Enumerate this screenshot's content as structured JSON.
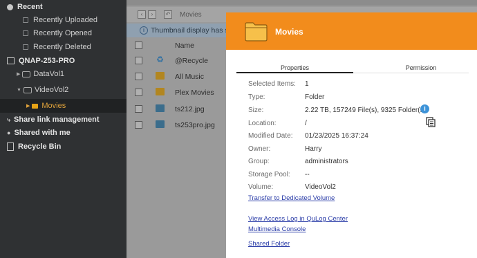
{
  "sidebar": {
    "recent": "Recent",
    "recent_items": [
      "Recently Uploaded",
      "Recently Opened",
      "Recently Deleted"
    ],
    "nas": "QNAP-253-PRO",
    "volumes": [
      "DataVol1",
      "VideoVol2"
    ],
    "active_folder": "Movies",
    "share_link": "Share link management",
    "shared_with_me": "Shared with me",
    "recycle_bin": "Recycle Bin"
  },
  "pathbar": {
    "path": "Movies"
  },
  "infobar": {
    "text": "Thumbnail display has sto"
  },
  "filelist": {
    "header": "Name",
    "rows": [
      {
        "name": "@Recycle",
        "icon": "recycle-icon"
      },
      {
        "name": "All Music",
        "icon": "folder-icon"
      },
      {
        "name": "Plex Movies",
        "icon": "folder-icon"
      },
      {
        "name": "ts212.jpg",
        "icon": "image-icon"
      },
      {
        "name": "ts253pro.jpg",
        "icon": "image-icon"
      }
    ]
  },
  "panel": {
    "title": "Movies",
    "tabs": [
      "Properties",
      "Permission"
    ],
    "labels": [
      "Selected Items:",
      "Type:",
      "Size:",
      "Location:",
      "Modified Date:",
      "Owner:",
      "Group:",
      "Storage Pool:",
      "Volume:"
    ],
    "values": [
      "1",
      "Folder",
      "2.22 TB, 157249 File(s), 9325 Folder(s)",
      "/",
      "01/23/2025 16:37:24",
      "Harry",
      "administrators",
      "--",
      "VideoVol2"
    ],
    "links": [
      "Transfer to Dedicated Volume",
      "View Access Log in QuLog Center",
      "Multimedia Console",
      "Shared Folder"
    ]
  },
  "colors": {
    "accent": "#f28c1c",
    "link": "#2b3da8",
    "active_folder": "#e0a33b",
    "info": "#3d93d8"
  }
}
